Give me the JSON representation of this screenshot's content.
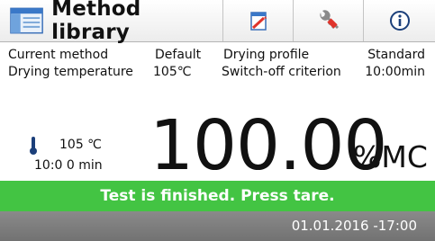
{
  "header": {
    "title": "Method library",
    "icons": [
      "method-library-icon",
      "notepad-icon",
      "wrench-icon",
      "info-icon"
    ]
  },
  "method_info": {
    "current_method_label": "Current method",
    "current_method_value": "Default",
    "drying_profile_label": "Drying profile",
    "drying_profile_value": "Standard",
    "drying_temperature_label": "Drying temperature",
    "drying_temperature_value": "105℃",
    "switch_off_label": "Switch-off criterion",
    "switch_off_value": "10:00min"
  },
  "measurement": {
    "temperature": "105 ℃",
    "time": "10:0 0 min",
    "value": "100.00",
    "unit": "%MC"
  },
  "status": {
    "message": "Test is finished. Press tare.",
    "color": "#43c443"
  },
  "footer": {
    "datetime": "01.01.2016 -17:00"
  }
}
